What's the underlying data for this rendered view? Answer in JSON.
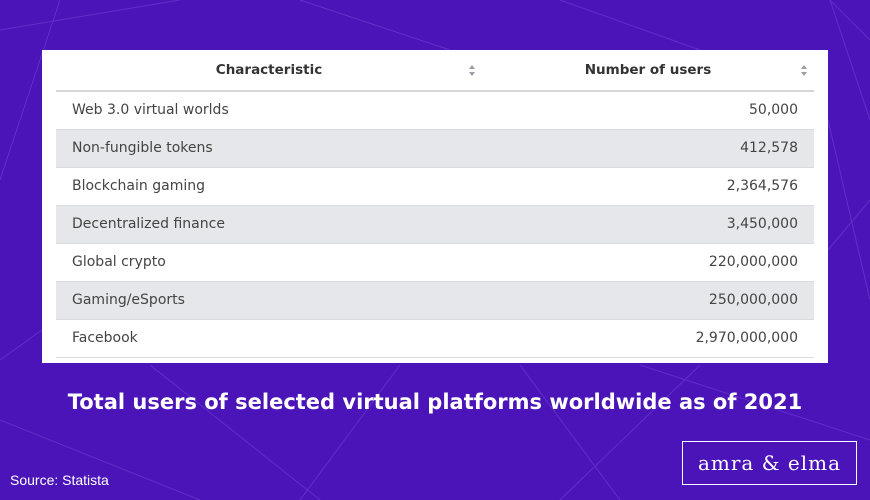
{
  "chart_data": {
    "type": "table",
    "columns": [
      "Characteristic",
      "Number of users"
    ],
    "rows": [
      {
        "label": "Web 3.0 virtual worlds",
        "value": "50,000"
      },
      {
        "label": "Non-fungible tokens",
        "value": "412,578"
      },
      {
        "label": "Blockchain gaming",
        "value": "2,364,576"
      },
      {
        "label": "Decentralized finance",
        "value": "3,450,000"
      },
      {
        "label": "Global crypto",
        "value": "220,000,000"
      },
      {
        "label": "Gaming/eSports",
        "value": "250,000,000"
      },
      {
        "label": "Facebook",
        "value": "2,970,000,000"
      }
    ],
    "values": [
      50000,
      412578,
      2364576,
      3450000,
      220000000,
      250000000,
      2970000000
    ],
    "title": "Total users of selected virtual platforms worldwide as of  2021"
  },
  "caption": "Total users of selected virtual platforms worldwide as of  2021",
  "source": "Source: Statista",
  "logo": "amra & elma",
  "colors": {
    "background": "#4a14b8",
    "row_alt": "#e5e7ea",
    "text": "#444444"
  }
}
